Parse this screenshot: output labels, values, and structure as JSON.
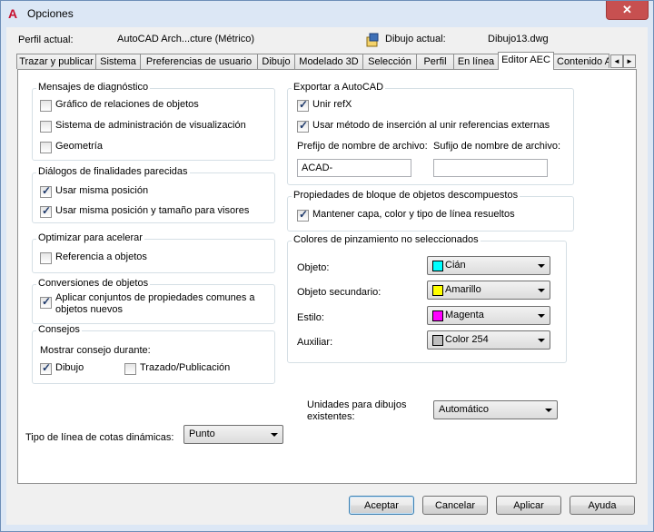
{
  "window": {
    "title": "Opciones",
    "close_glyph": "✕",
    "app_icon": "A"
  },
  "header": {
    "profile_label": "Perfil actual:",
    "profile_value": "AutoCAD Arch...cture (Métrico)",
    "drawing_label": "Dibujo actual:",
    "drawing_value": "Dibujo13.dwg"
  },
  "tabs": [
    {
      "label": "Trazar y publicar"
    },
    {
      "label": "Sistema"
    },
    {
      "label": "Preferencias de usuario"
    },
    {
      "label": "Dibujo"
    },
    {
      "label": "Modelado 3D"
    },
    {
      "label": "Selección"
    },
    {
      "label": "Perfil"
    },
    {
      "label": "En línea"
    },
    {
      "label": "Editor AEC",
      "active": true
    },
    {
      "label": "Contenido A"
    }
  ],
  "tab_scroll": {
    "left": "◄",
    "right": "►"
  },
  "diagnostics": {
    "title": "Mensajes de diagnóstico",
    "items": [
      {
        "label": "Gráfico de relaciones de objetos",
        "checked": false
      },
      {
        "label": "Sistema de administración de visualización",
        "checked": false
      },
      {
        "label": "Geometría",
        "checked": false
      }
    ]
  },
  "similar_dialogs": {
    "title": "Diálogos de finalidades parecidas",
    "items": [
      {
        "label": "Usar misma posición",
        "checked": true
      },
      {
        "label": "Usar misma posición y tamaño para visores",
        "checked": true
      }
    ]
  },
  "optimize": {
    "title": "Optimizar para acelerar",
    "items": [
      {
        "label": "Referencia a objetos",
        "checked": false
      }
    ]
  },
  "conversions": {
    "title": "Conversiones de objetos",
    "items": [
      {
        "label_line1": "Aplicar conjuntos de propiedades comunes a",
        "label_line2": "objetos nuevos",
        "checked": true
      }
    ]
  },
  "tips": {
    "title": "Consejos",
    "subtitle": "Mostrar consejo durante:",
    "items": [
      {
        "label": "Dibujo",
        "checked": true
      },
      {
        "label": "Trazado/Publicación",
        "checked": false
      }
    ]
  },
  "dim_linetype": {
    "label": "Tipo de línea de cotas dinámicas:",
    "value": "Punto"
  },
  "export": {
    "title": "Exportar a AutoCAD",
    "items": [
      {
        "label": "Unir refX",
        "checked": true
      },
      {
        "label": "Usar método de inserción al unir referencias externas",
        "checked": true
      }
    ],
    "prefix_label": "Prefijo de nombre de archivo:",
    "prefix_value": "ACAD-",
    "suffix_label": "Sufijo de nombre de archivo:",
    "suffix_value": ""
  },
  "block_props": {
    "title": "Propiedades de bloque de objetos descompuestos",
    "items": [
      {
        "label": "Mantener capa, color y tipo de línea resueltos",
        "checked": true
      }
    ]
  },
  "grip_colors": {
    "title": "Colores de pinzamiento no seleccionados",
    "rows": [
      {
        "label": "Objeto:",
        "value": "Cián",
        "color": "#00ffff"
      },
      {
        "label": "Objeto secundario:",
        "value": "Amarillo",
        "color": "#ffff00"
      },
      {
        "label": "Estilo:",
        "value": "Magenta",
        "color": "#ff00ff"
      },
      {
        "label": "Auxiliar:",
        "value": "Color 254",
        "color": "#bebebe"
      }
    ]
  },
  "units": {
    "label_line1": "Unidades para dibujos",
    "label_line2": "existentes:",
    "value": "Automático"
  },
  "buttons": {
    "accept": "Aceptar",
    "cancel": "Cancelar",
    "apply": "Aplicar",
    "help": "Ayuda"
  }
}
